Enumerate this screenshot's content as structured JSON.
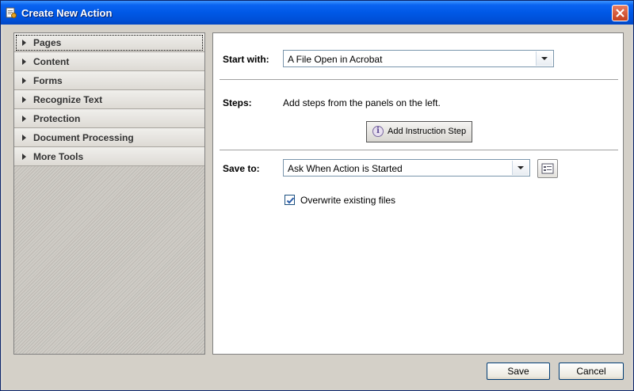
{
  "window": {
    "title": "Create New Action"
  },
  "sidebar": {
    "items": [
      {
        "label": "Pages"
      },
      {
        "label": "Content"
      },
      {
        "label": "Forms"
      },
      {
        "label": "Recognize Text"
      },
      {
        "label": "Protection"
      },
      {
        "label": "Document Processing"
      },
      {
        "label": "More Tools"
      }
    ]
  },
  "form": {
    "start_with": {
      "label": "Start with:",
      "value": "A File Open in Acrobat"
    },
    "steps": {
      "label": "Steps:",
      "hint": "Add steps from the panels on the left.",
      "add_button": "Add Instruction Step"
    },
    "save_to": {
      "label": "Save to:",
      "value": "Ask When Action is Started"
    },
    "overwrite": {
      "label": "Overwrite existing files",
      "checked": true
    }
  },
  "footer": {
    "save_label": "Save",
    "cancel_label": "Cancel"
  },
  "colors": {
    "titlebar": "#0058e6",
    "close_button": "#c4401d",
    "checkbox_mark": "#2a5ca8"
  }
}
